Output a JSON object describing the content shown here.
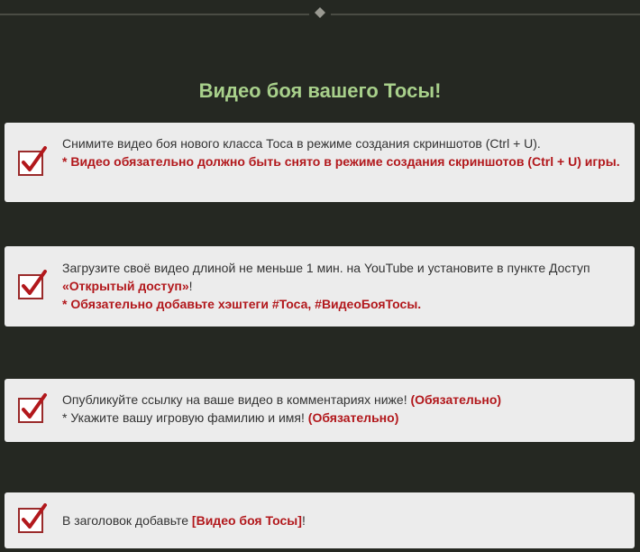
{
  "page": {
    "title": "Видео боя вашего Тосы!",
    "colors": {
      "background": "#252822",
      "title": "#a8d08b",
      "accent": "#b2181c",
      "card": "#ececec"
    }
  },
  "steps": [
    {
      "line1": "Снимите видео боя нового класса Тоса в режиме создания скриншотов (Ctrl + U).",
      "note": "* Видео обязательно должно быть снято в режиме создания скриншотов (Ctrl + U) игры."
    },
    {
      "line1_prefix": "Загрузите своё видео длиной не меньше 1 мин. на YouTube и установите в пункте Доступ ",
      "line1_highlight": "«Открытый доступ»",
      "line1_suffix": "!",
      "note": "* Обязательно добавьте хэштеги #Тоса, #ВидеоБояТосы."
    },
    {
      "line1_prefix": "Опубликуйте ссылку на ваше видео в комментариях ниже! ",
      "line1_highlight": "(Обязательно)",
      "line2_prefix": "* Укажите вашу игровую фамилию и имя! ",
      "line2_highlight": "(Обязательно)"
    },
    {
      "line1_prefix": "В заголовок добавьте ",
      "line1_highlight": "[Видео боя Тосы]",
      "line1_suffix": "!"
    }
  ],
  "icons": {
    "check": "checkbox-checked-icon",
    "divider": "diamond-divider-icon"
  }
}
